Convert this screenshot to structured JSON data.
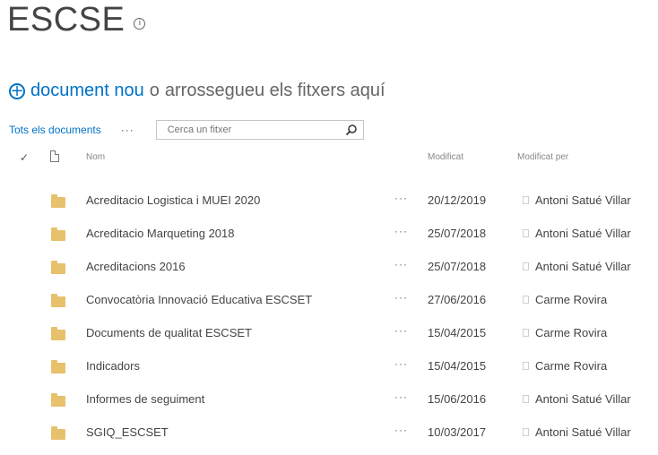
{
  "page": {
    "title": "ESCSE"
  },
  "new_document": {
    "link_label": "document nou",
    "or_label": "o",
    "drag_label": "arrossegueu els fitxers aquí"
  },
  "toolbar": {
    "view_label": "Tots els documents",
    "more_label": "···",
    "search_placeholder": "Cerca un fitxer"
  },
  "columns": {
    "check": "✓",
    "name": "Nom",
    "modified": "Modificat",
    "modified_by": "Modificat per"
  },
  "items": [
    {
      "name": "Acreditacio Logistica i MUEI 2020",
      "more": "···",
      "modified": "20/12/2019",
      "modified_by": "Antoni Satué Villar"
    },
    {
      "name": "Acreditacio Marqueting 2018",
      "more": "···",
      "modified": "25/07/2018",
      "modified_by": "Antoni Satué Villar"
    },
    {
      "name": "Acreditacions 2016",
      "more": "···",
      "modified": "25/07/2018",
      "modified_by": "Antoni Satué Villar"
    },
    {
      "name": "Convocatòria Innovació Educativa ESCSET",
      "more": "···",
      "modified": "27/06/2016",
      "modified_by": "Carme Rovira"
    },
    {
      "name": "Documents de qualitat ESCSET",
      "more": "···",
      "modified": "15/04/2015",
      "modified_by": "Carme Rovira"
    },
    {
      "name": "Indicadors",
      "more": "···",
      "modified": "15/04/2015",
      "modified_by": "Carme Rovira"
    },
    {
      "name": "Informes de seguiment",
      "more": "···",
      "modified": "15/06/2016",
      "modified_by": "Antoni Satué Villar"
    },
    {
      "name": "SGIQ_ESCSET",
      "more": "···",
      "modified": "10/03/2017",
      "modified_by": "Antoni Satué Villar"
    }
  ],
  "colors": {
    "accent": "#0072c6",
    "folder": "#e7c16b",
    "text": "#444444"
  },
  "icons": {
    "info": "info-icon",
    "add": "plus-circle-icon",
    "search": "search-icon",
    "folder": "folder-icon",
    "document": "document-icon",
    "check": "check-icon"
  }
}
